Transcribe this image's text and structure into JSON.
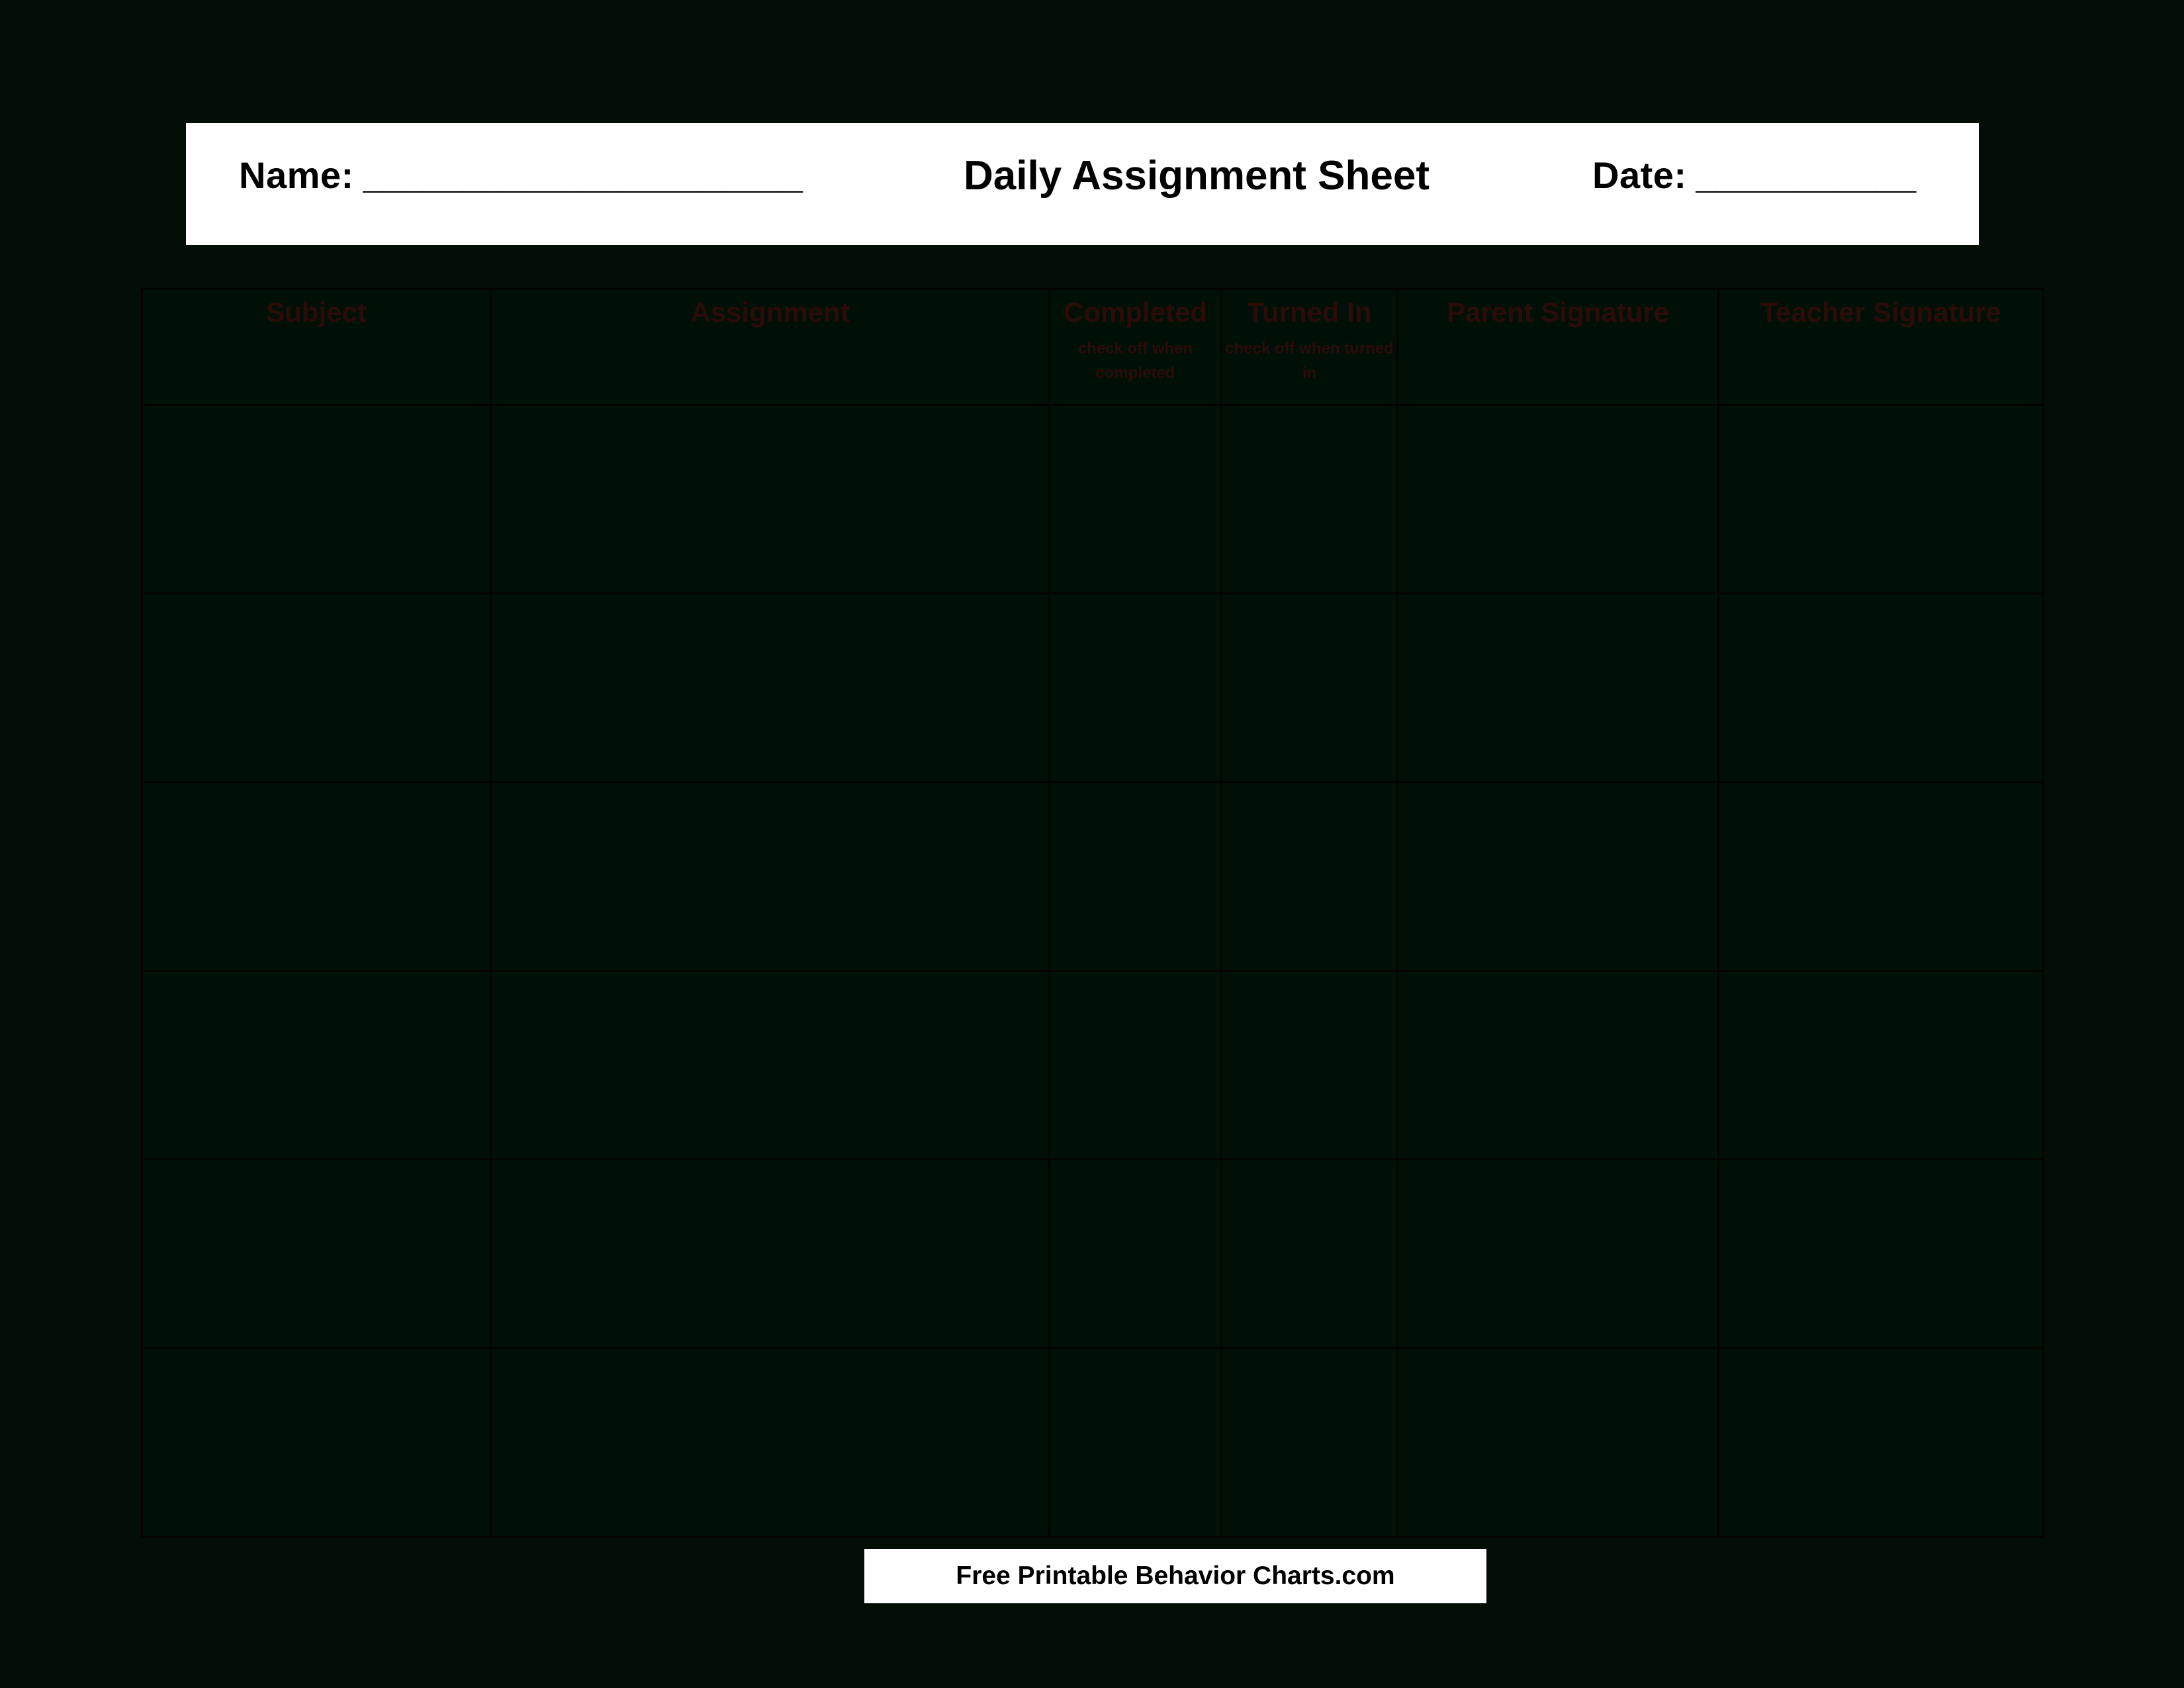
{
  "page": {
    "background_color": "#010d05",
    "paper_color": "#ffffff",
    "table_cell_color": "#011006",
    "table_border_color": "#030402",
    "header_text_color": "#2b0c09"
  },
  "header": {
    "name_label": "Name:",
    "name_blank": "______________________",
    "title": "Daily Assignment Sheet",
    "date_label": "Date:",
    "date_blank": "___________"
  },
  "table": {
    "columns": [
      {
        "title": "Subject",
        "subtitle": ""
      },
      {
        "title": "Assignment",
        "subtitle": ""
      },
      {
        "title": "Completed",
        "subtitle": "check off when completed"
      },
      {
        "title": "Turned In",
        "subtitle": "check off when turned in"
      },
      {
        "title": "Parent Signature",
        "subtitle": ""
      },
      {
        "title": "Teacher Signature",
        "subtitle": ""
      }
    ],
    "rows": [
      [
        "",
        "",
        "",
        "",
        "",
        ""
      ],
      [
        "",
        "",
        "",
        "",
        "",
        ""
      ],
      [
        "",
        "",
        "",
        "",
        "",
        ""
      ],
      [
        "",
        "",
        "",
        "",
        "",
        ""
      ],
      [
        "",
        "",
        "",
        "",
        "",
        ""
      ],
      [
        "",
        "",
        "",
        "",
        "",
        ""
      ]
    ]
  },
  "footer": {
    "text": "Free Printable Behavior Charts.com"
  }
}
